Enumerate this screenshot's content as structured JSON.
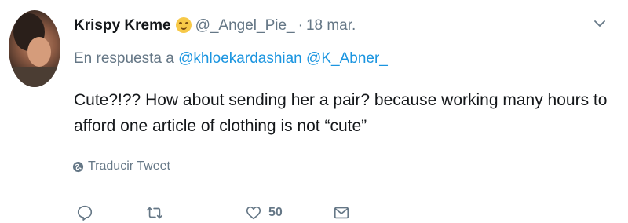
{
  "tweet": {
    "author_name": "Krispy Kreme",
    "emoji_icon": "relieved-face-emoji",
    "handle": "@_Angel_Pie_",
    "separator": "·",
    "date": "18 mar.",
    "reply_prefix": "En respuesta a",
    "reply_to": [
      "@khloekardashian",
      "@K_Abner_"
    ],
    "text": "Cute?!?? How about sending her a pair? because working many hours to afford one article of clothing is not “cute”",
    "translate_label": "Traducir Tweet",
    "actions": {
      "reply_icon": "reply-icon",
      "retweet_icon": "retweet-icon",
      "like_icon": "heart-icon",
      "like_count": "50",
      "dm_icon": "envelope-icon"
    }
  },
  "colors": {
    "text": "#14171a",
    "muted": "#657786",
    "link": "#1b95e0"
  }
}
